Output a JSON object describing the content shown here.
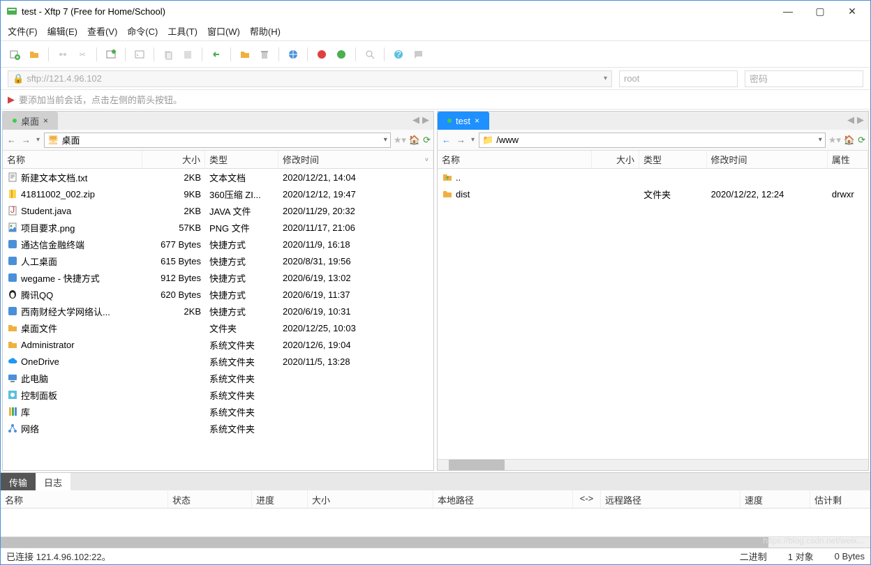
{
  "window": {
    "title": "test - Xftp 7 (Free for Home/School)"
  },
  "menu": {
    "file": "文件(F)",
    "edit": "编辑(E)",
    "view": "查看(V)",
    "cmd": "命令(C)",
    "tool": "工具(T)",
    "window": "窗口(W)",
    "help": "帮助(H)"
  },
  "address": {
    "url": "sftp://121.4.96.102",
    "user_placeholder": "root",
    "pass_placeholder": "密码"
  },
  "hint": "要添加当前会话，点击左侧的箭头按钮。",
  "left": {
    "tab": "桌面",
    "path": "桌面",
    "columns": {
      "name": "名称",
      "size": "大小",
      "type": "类型",
      "date": "修改时间"
    },
    "rows": [
      {
        "name": "新建文本文档.txt",
        "size": "2KB",
        "type": "文本文档",
        "date": "2020/12/21, 14:04",
        "icon": "text"
      },
      {
        "name": "41811002_002.zip",
        "size": "9KB",
        "type": "360压缩 ZI...",
        "date": "2020/12/12, 19:47",
        "icon": "zip"
      },
      {
        "name": "Student.java",
        "size": "2KB",
        "type": "JAVA 文件",
        "date": "2020/11/29, 20:32",
        "icon": "java"
      },
      {
        "name": "项目要求.png",
        "size": "57KB",
        "type": "PNG 文件",
        "date": "2020/11/17, 21:06",
        "icon": "png"
      },
      {
        "name": "通达信金融终端",
        "size": "677 Bytes",
        "type": "快捷方式",
        "date": "2020/11/9, 16:18",
        "icon": "app"
      },
      {
        "name": "人工桌面",
        "size": "615 Bytes",
        "type": "快捷方式",
        "date": "2020/8/31, 19:56",
        "icon": "app"
      },
      {
        "name": "wegame - 快捷方式",
        "size": "912 Bytes",
        "type": "快捷方式",
        "date": "2020/6/19, 13:02",
        "icon": "app"
      },
      {
        "name": "腾讯QQ",
        "size": "620 Bytes",
        "type": "快捷方式",
        "date": "2020/6/19, 11:37",
        "icon": "qq"
      },
      {
        "name": "西南财经大学网络认...",
        "size": "2KB",
        "type": "快捷方式",
        "date": "2020/6/19, 10:31",
        "icon": "app"
      },
      {
        "name": "桌面文件",
        "size": "",
        "type": "文件夹",
        "date": "2020/12/25, 10:03",
        "icon": "folder"
      },
      {
        "name": "Administrator",
        "size": "",
        "type": "系统文件夹",
        "date": "2020/12/6, 19:04",
        "icon": "folder"
      },
      {
        "name": "OneDrive",
        "size": "",
        "type": "系统文件夹",
        "date": "2020/11/5, 13:28",
        "icon": "cloud"
      },
      {
        "name": "此电脑",
        "size": "",
        "type": "系统文件夹",
        "date": "",
        "icon": "pc"
      },
      {
        "name": "控制面板",
        "size": "",
        "type": "系统文件夹",
        "date": "",
        "icon": "panel"
      },
      {
        "name": "库",
        "size": "",
        "type": "系统文件夹",
        "date": "",
        "icon": "lib"
      },
      {
        "name": "网络",
        "size": "",
        "type": "系统文件夹",
        "date": "",
        "icon": "net"
      }
    ]
  },
  "right": {
    "tab": "test",
    "path": "/www",
    "columns": {
      "name": "名称",
      "size": "大小",
      "type": "类型",
      "date": "修改时间",
      "attr": "属性"
    },
    "rows": [
      {
        "name": "..",
        "size": "",
        "type": "",
        "date": "",
        "attr": "",
        "icon": "up"
      },
      {
        "name": "dist",
        "size": "",
        "type": "文件夹",
        "date": "2020/12/22, 12:24",
        "attr": "drwxr",
        "icon": "folder"
      }
    ]
  },
  "bottom_tabs": {
    "transfer": "传输",
    "log": "日志"
  },
  "transfer_cols": {
    "name": "名称",
    "status": "状态",
    "progress": "进度",
    "size": "大小",
    "local": "本地路径",
    "arrow": "<->",
    "remote": "远程路径",
    "speed": "速度",
    "eta": "估计剩"
  },
  "status": {
    "connected": "已连接 121.4.96.102:22。",
    "binary": "二进制",
    "objects": "1 对象",
    "bytes": "0 Bytes"
  },
  "watermark": "https://blog.csdn.net/weix..."
}
